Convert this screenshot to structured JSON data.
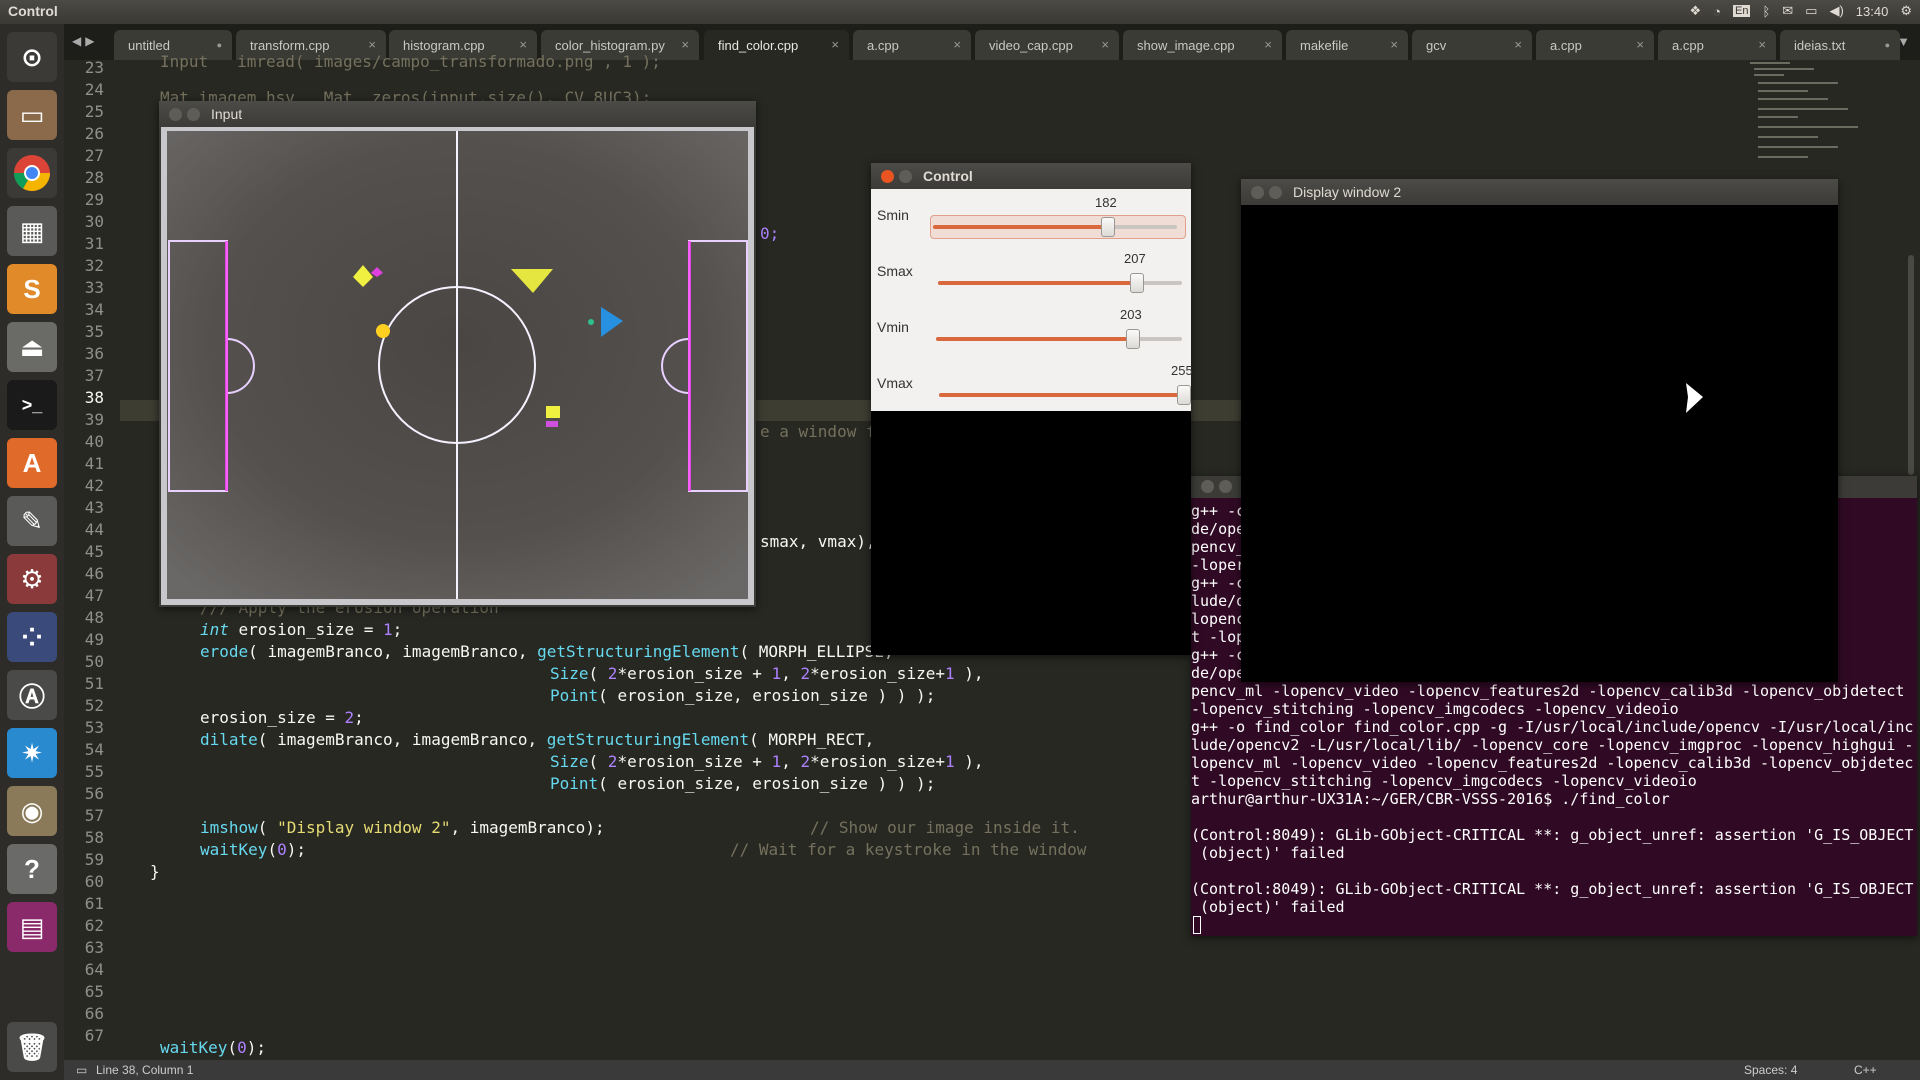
{
  "topbar": {
    "title": "Control",
    "tray": {
      "keyboard": "En",
      "time": "13:40"
    }
  },
  "tabs": [
    {
      "label": "untitled"
    },
    {
      "label": "transform.cpp"
    },
    {
      "label": "histogram.cpp"
    },
    {
      "label": "color_histogram.py"
    },
    {
      "label": "find_color.cpp"
    },
    {
      "label": "a.cpp"
    },
    {
      "label": "video_cap.cpp"
    },
    {
      "label": "show_image.cpp"
    },
    {
      "label": "makefile"
    },
    {
      "label": "gcv"
    },
    {
      "label": "a.cpp"
    },
    {
      "label": "a.cpp"
    },
    {
      "label": "ideias.txt"
    }
  ],
  "line_numbers": [
    "23",
    "24",
    "25",
    "26",
    "27",
    "28",
    "29",
    "30",
    "31",
    "32",
    "33",
    "34",
    "35",
    "36",
    "37",
    "38",
    "39",
    "40",
    "41",
    "42",
    "43",
    "44",
    "45",
    "46",
    "47",
    "48",
    "49",
    "50",
    "51",
    "52",
    "53",
    "54",
    "55",
    "56",
    "57",
    "58",
    "59",
    "60",
    "61",
    "62",
    "63",
    "64",
    "65",
    "66",
    "67"
  ],
  "code": {
    "l29_tail": "0;",
    "l38_tail": "e a window fo",
    "l43_tail": "smax, vmax),",
    "l46_comment": "/// Apply the erosion operation",
    "l47_int": "int",
    "l47_rest": " erosion_size = ",
    "l47_num": "1",
    "l47_end": ";",
    "l48_fn": "erode",
    "l48_a": "( imagemBranco, imagemBranco, ",
    "l48_b": "getStructuringElement",
    "l48_c": "( MORPH_ELLIPSE,",
    "l49_size": "Size",
    "l49_a": "( ",
    "l49_two": "2",
    "l49_b": "*erosion_size + ",
    "l49_one": "1",
    "l49_c": ", ",
    "l49_two2": "2",
    "l49_d": "*erosion_size+",
    "l49_one2": "1",
    "l49_e": " ),",
    "l50_point": "Point",
    "l50_rest": "( erosion_size, erosion_size ) ) );",
    "l51_a": "erosion_size = ",
    "l51_num": "2",
    "l51_end": ";",
    "l52_fn": "dilate",
    "l52_a": "( imagemBranco, imagemBranco, ",
    "l52_b": "getStructuringElement",
    "l52_c": "( MORPH_RECT,",
    "l56_fn": "imshow",
    "l56_a": "( ",
    "l56_str": "\"Display window 2\"",
    "l56_b": ", imagemBranco);",
    "l56_cm": "// Show our image inside it.",
    "l57_fn": "waitKey",
    "l57_a": "(",
    "l57_num": "0",
    "l57_b": ");",
    "l57_cm": "// Wait for a keystroke in the window",
    "l58": "}",
    "l66_fn": "waitKey",
    "l66_a": "(",
    "l66_num": "0",
    "l66_b": ");"
  },
  "input_window": {
    "title": "Input"
  },
  "control_window": {
    "title": "Control",
    "sliders": [
      {
        "label": "Smin",
        "value": "182",
        "fraction": 0.714
      },
      {
        "label": "Smax",
        "value": "207",
        "fraction": 0.812
      },
      {
        "label": "Vmin",
        "value": "203",
        "fraction": 0.796
      },
      {
        "label": "Vmax",
        "value": "255",
        "fraction": 1.0
      }
    ]
  },
  "display_window": {
    "title": "Display window 2"
  },
  "terminal": {
    "lines": [
      "g++ -c                                                      al/inclu",
      "de/ope                                                      highgui -lo",
      "pencv_                                                      jdetect",
      "-loper",
      "g++ -c                                                      local/inc",
      "lude/o                                                      ighgui -",
      "lopenc                                                      objdetec",
      "t -lop",
      "g++ -c                                                      al/inclu",
      "de/ope                                                      highgui -lo",
      "pencv_ml -lopencv_video -lopencv_features2d -lopencv_calib3d -lopencv_objdetect",
      "-lopencv_stitching -lopencv_imgcodecs -lopencv_videoio",
      "g++ -o find_color find_color.cpp -g -I/usr/local/include/opencv -I/usr/local/inc",
      "lude/opencv2 -L/usr/local/lib/ -lopencv_core -lopencv_imgproc -lopencv_highgui -",
      "lopencv_ml -lopencv_video -lopencv_features2d -lopencv_calib3d -lopencv_objdetec",
      "t -lopencv_stitching -lopencv_imgcodecs -lopencv_videoio",
      "arthur@arthur-UX31A:~/GER/CBR-VSSS-2016$ ./find_color",
      "",
      "(Control:8049): GLib-GObject-CRITICAL **: g_object_unref: assertion 'G_IS_OBJECT",
      " (object)' failed",
      "",
      "(Control:8049): GLib-GObject-CRITICAL **: g_object_unref: assertion 'G_IS_OBJECT",
      " (object)' failed"
    ]
  },
  "statusbar": {
    "position": "Line 38, Column 1",
    "spaces": "Spaces: 4",
    "syntax": "C++"
  },
  "colors": {
    "editor_bg": "#272822",
    "terminal_bg": "#300a24",
    "accent": "#d9683c"
  }
}
